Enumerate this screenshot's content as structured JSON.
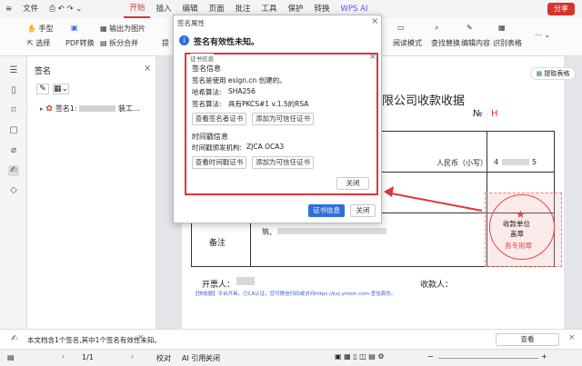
{
  "menu": {
    "file": "文件",
    "tabs": [
      "开始",
      "插入",
      "编辑",
      "页面",
      "批注",
      "工具",
      "保护",
      "转换"
    ],
    "wps_ai": "WPS AI",
    "share": "分享"
  },
  "toolbar": {
    "hand": "手型",
    "select": "选择",
    "pdf_convert": "PDF转换",
    "export_image": "输出为图片",
    "split_merge": "拆分合并",
    "extract_partial": "提",
    "reading_mode": "阅读模式",
    "find_replace": "查找替换",
    "edit_text": "编辑内容",
    "recognize_table": "识别表格",
    "extract_table": "提取表格"
  },
  "sidebar": {
    "title": "签名",
    "sig_item": "签名1: ",
    "sig_item_tail": "装工..."
  },
  "dialog": {
    "title": "签名属性",
    "headline": "签名有效性未知。",
    "tab": "证书信息",
    "sig_section": "签名信息",
    "signed_by": "签名是使用 esign.cn  创建的。",
    "hash_label": "哈希算法:",
    "hash_value": "SHA256",
    "sig_alg_label": "签名算法:",
    "sig_alg_value": "具有PKCS#1 v.1.5的RSA",
    "view_signer_cert": "查看签名者证书",
    "add_trusted_1": "添加为可信任证书",
    "ts_section": "时间戳信息",
    "ts_issuer_label": "时间戳颁发机构:",
    "ts_issuer_value": "ZJCA OCA3",
    "view_ts_cert": "查看时间戳证书",
    "add_trusted_2": "添加为可信任证书",
    "close_inner": "关闭",
    "cert_info_btn": "证书信息",
    "close_outer": "关闭"
  },
  "document": {
    "title_part": "限公司收款收据",
    "no_label": "№",
    "no_value": "H",
    "rmb_label": "人民币（小写）",
    "rmb_value": "4",
    "rmb_tail": "5",
    "remark_label": "备注",
    "remark_text": "筑、",
    "issuer_label": "开票人：",
    "payee_label": "收款人：",
    "stamp_line1": "收款单位",
    "stamp_line2": "盖章",
    "stamp_line3": "务专用章",
    "footer_note": "【快收据】平台开具，已CA认证，您可微信扫码或访问https://kxj.ymlon.com 查验真伪。"
  },
  "notice": {
    "text": "本文档含1个签名,其中1个签名有效性未知。",
    "view_btn": "查看"
  },
  "status": {
    "page": "1/1",
    "proofread": "校对",
    "ai_ref": "AI 引用:",
    "ai_ref_value": "关闭",
    "zoom": "75%"
  }
}
